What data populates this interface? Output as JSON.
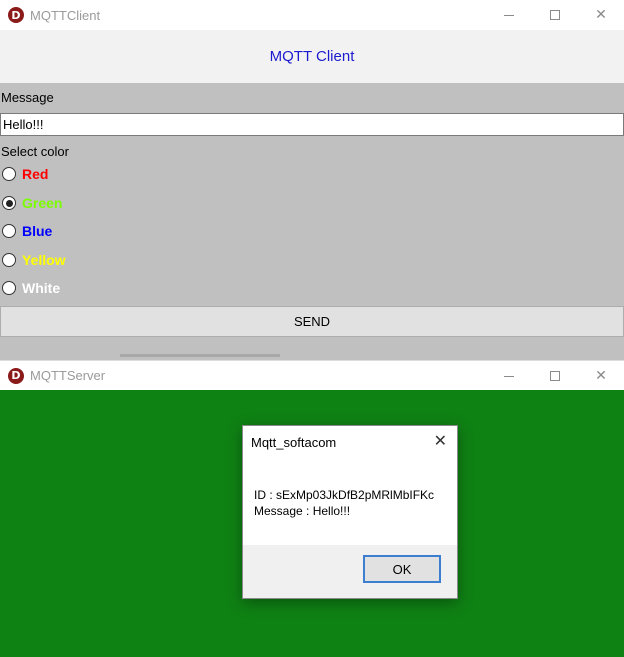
{
  "client": {
    "window_title": "MQTTClient",
    "header_title": "MQTT Client",
    "message_label": "Message",
    "message_value": "Hello!!!",
    "color_label": "Select color",
    "colors": [
      {
        "label": "Red",
        "color": "#ff0000",
        "checked": false
      },
      {
        "label": "Green",
        "color": "#7cfc00",
        "checked": true
      },
      {
        "label": "Blue",
        "color": "#0000ff",
        "checked": false
      },
      {
        "label": "Yellow",
        "color": "#ffff00",
        "checked": false
      },
      {
        "label": "White",
        "color": "#ffffff",
        "checked": false
      }
    ],
    "send_label": "SEND"
  },
  "server": {
    "window_title": "MQTTServer",
    "background_color": "#0f8214"
  },
  "dialog": {
    "title": "Mqtt_softacom",
    "id_line": "ID : sExMp03JkDfB2pMRlMbIFKc",
    "message_line": "Message : Hello!!!",
    "ok_label": "OK"
  },
  "icons": {
    "app_logo": "D",
    "close": "✕"
  }
}
